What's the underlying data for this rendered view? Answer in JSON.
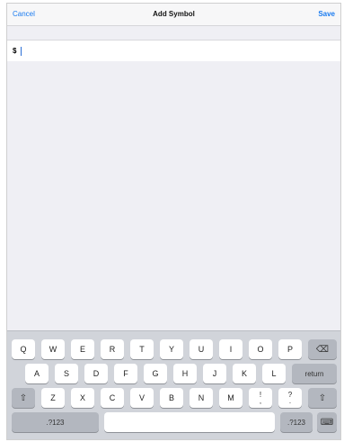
{
  "navbar": {
    "cancel_label": "Cancel",
    "title": "Add Symbol",
    "save_label": "Save"
  },
  "symbol_input": {
    "value": "$"
  },
  "keyboard": {
    "row1": [
      "Q",
      "W",
      "E",
      "R",
      "T",
      "Y",
      "U",
      "I",
      "O",
      "P"
    ],
    "row2": [
      "A",
      "S",
      "D",
      "F",
      "G",
      "H",
      "J",
      "K",
      "L"
    ],
    "row3": [
      "Z",
      "X",
      "C",
      "V",
      "B",
      "N",
      "M"
    ],
    "return_label": "return",
    "numbers_label": ".?123",
    "backspace_glyph": "⌫",
    "shift_glyph": "⇧",
    "punct_excl_top": "!",
    "punct_excl_bottom": ",",
    "punct_q_top": "?",
    "punct_q_bottom": ".",
    "hide_keyboard_glyph": "⌨"
  }
}
